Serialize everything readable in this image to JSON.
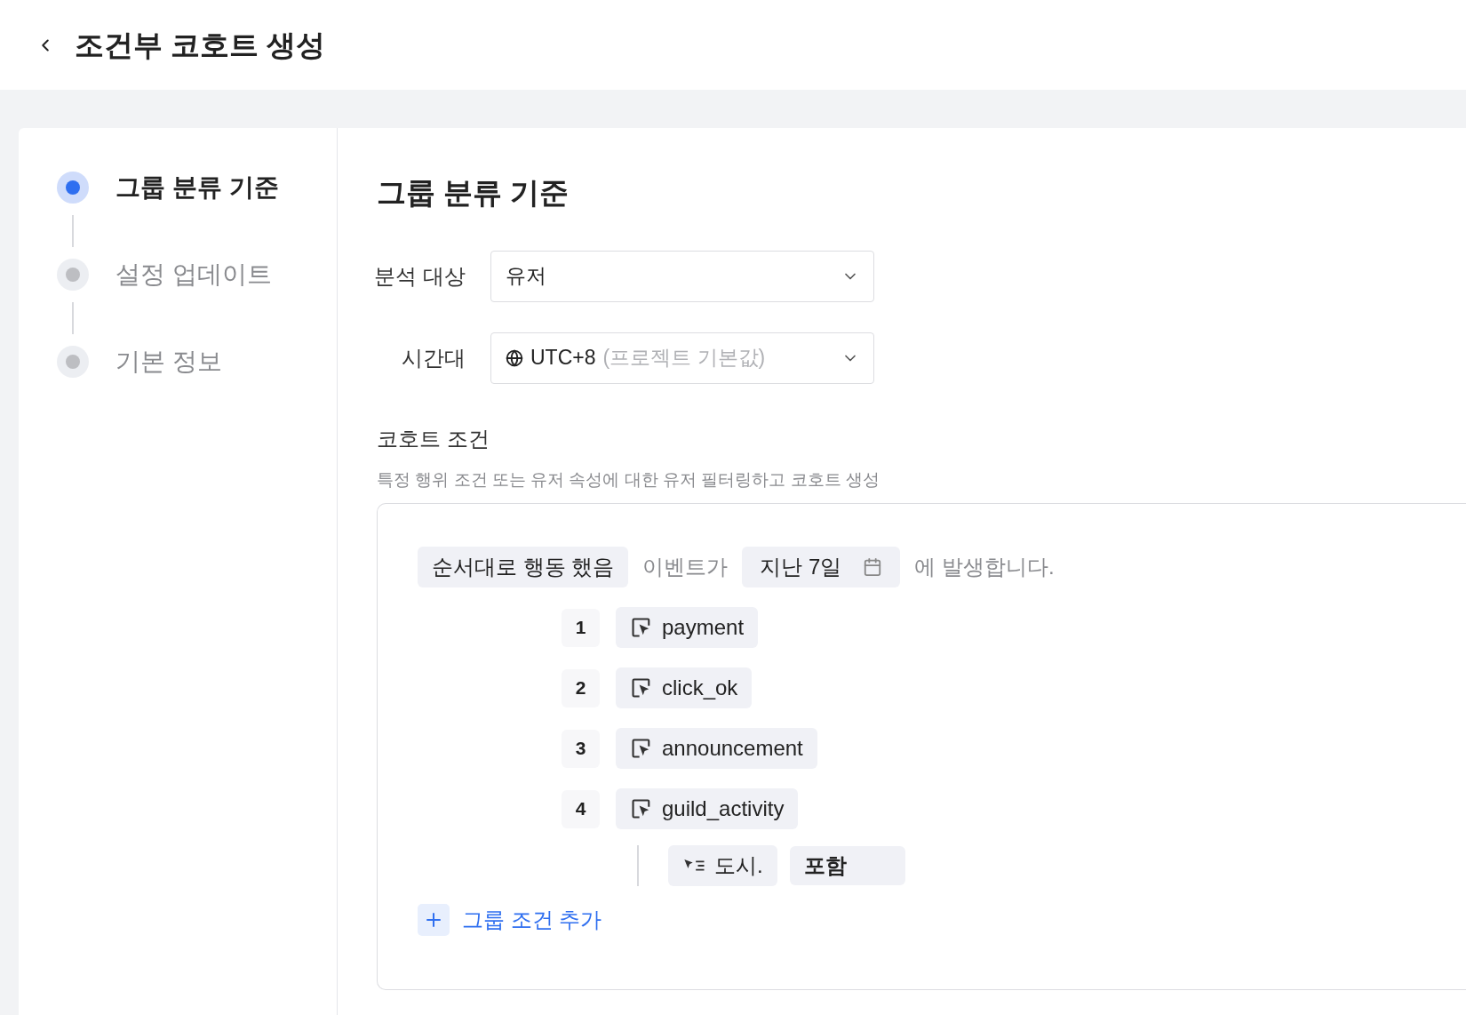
{
  "header": {
    "title": "조건부 코호트 생성"
  },
  "steps": [
    {
      "label": "그룹 분류 기준",
      "selected": true
    },
    {
      "label": "설정 업데이트",
      "selected": false
    },
    {
      "label": "기본 정보",
      "selected": false
    }
  ],
  "section": {
    "title": "그룹 분류 기준"
  },
  "fields": [
    {
      "label": "분석 대상",
      "value": "유저",
      "kind": "plain"
    },
    {
      "label": "시간대",
      "value": "UTC+8",
      "hint": "(프로젝트 기본값)",
      "kind": "timezone"
    }
  ],
  "cohort": {
    "title": "코호트 조건",
    "description": "특정 행위 조건 또는 유저 속성에 대한 유저 필터링하고 코호트 생성",
    "condition": {
      "behavior": "순서대로 행동 했음",
      "connector": "이벤트가",
      "period": "지난 7일",
      "suffix": "에 발생합니다."
    },
    "events": [
      {
        "index": "1",
        "name": "payment"
      },
      {
        "index": "2",
        "name": "click_ok"
      },
      {
        "index": "3",
        "name": "announcement"
      },
      {
        "index": "4",
        "name": "guild_activity",
        "filters": [
          {
            "property": "도시.",
            "operator": "포함"
          }
        ]
      }
    ],
    "add_button": "그룹 조건 추가"
  }
}
